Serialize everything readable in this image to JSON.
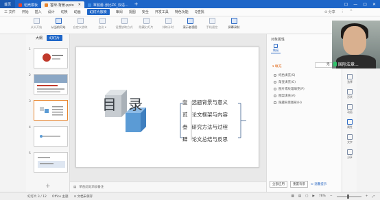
{
  "titlebar": {
    "home_label": "首页",
    "tabs": [
      {
        "label": "稻壳模板",
        "color": "#e8452c",
        "active": false
      },
      {
        "label": "答辩-背景.pptx",
        "color": "#e8842c",
        "active": true
      },
      {
        "label": "覃懿蕾-张比ZK_双语...",
        "color": "#3c8de8",
        "active": false
      }
    ],
    "plus": "+",
    "controls": [
      "▢",
      "—",
      "▢",
      "✕"
    ]
  },
  "menubar": {
    "items": [
      "三 文件",
      "开始",
      "插入",
      "设计",
      "切换",
      "动画",
      "幻灯片放映",
      "审阅",
      "视图",
      "安全",
      "开发工具",
      "特色功能",
      "Q查找"
    ],
    "selected_index": 6,
    "right": [
      "⊙ 分享",
      "⋮",
      "^"
    ]
  },
  "ribbon": {
    "buttons": [
      {
        "label": "从头开始",
        "strong": false
      },
      {
        "label": "从当前开始",
        "strong": true
      },
      {
        "label": "自定义放映",
        "strong": false
      },
      {
        "label": "会议 ▾",
        "strong": false
      },
      {
        "label": "设置放映方式",
        "strong": false
      },
      {
        "label": "隐藏幻灯片",
        "strong": false
      },
      {
        "label": "排练计时",
        "strong": false
      },
      {
        "label": "演示者视图",
        "strong": true
      },
      {
        "label": "手机遥控",
        "strong": false
      },
      {
        "label": "屏幕录制",
        "strong": true
      }
    ]
  },
  "leftpane": {
    "tabs": [
      "大纲",
      "幻灯片"
    ],
    "slide_numbers": [
      "1",
      "2",
      "3",
      "4",
      "5"
    ],
    "selected_slide": 2,
    "add": "+"
  },
  "slide": {
    "title_char1": "目",
    "title_char2": "录",
    "items": [
      {
        "num": "壹",
        "text": "选题背景与意义"
      },
      {
        "num": "贰",
        "text": "论文框架与内容"
      },
      {
        "num": "叁",
        "text": "研究方法与过程"
      },
      {
        "num": "肆",
        "text": "论文总结与反思"
      }
    ],
    "colors": {
      "block_gray": "#c7ccd1",
      "block_blue": "#5b9bd5",
      "accent": "#3c5f8c"
    }
  },
  "notes": {
    "text": "单击此处添加备注"
  },
  "rightpane": {
    "title": "对象属性",
    "tab_label": "填充",
    "section": "▾ 填充",
    "dropdown": "无",
    "options": [
      "纯色填充(S)",
      "渐变填充(G)",
      "图片或纹理填充(P)",
      "图案填充(A)",
      "隐藏背景图形(H)"
    ],
    "bottom_buttons": [
      "全部应用",
      "重置背景"
    ],
    "link": "⊙ 温馨提示"
  },
  "sidetools": [
    "选择",
    "形状",
    "动画",
    "属性",
    "文字",
    "分享"
  ],
  "webcam": {
    "label": "国际法章..."
  },
  "statusbar": {
    "slide_info": "幻灯片 3 / 12",
    "theme": "Office 主题",
    "doc_status": "⊙ 文档未保存",
    "zoom": "76%"
  }
}
